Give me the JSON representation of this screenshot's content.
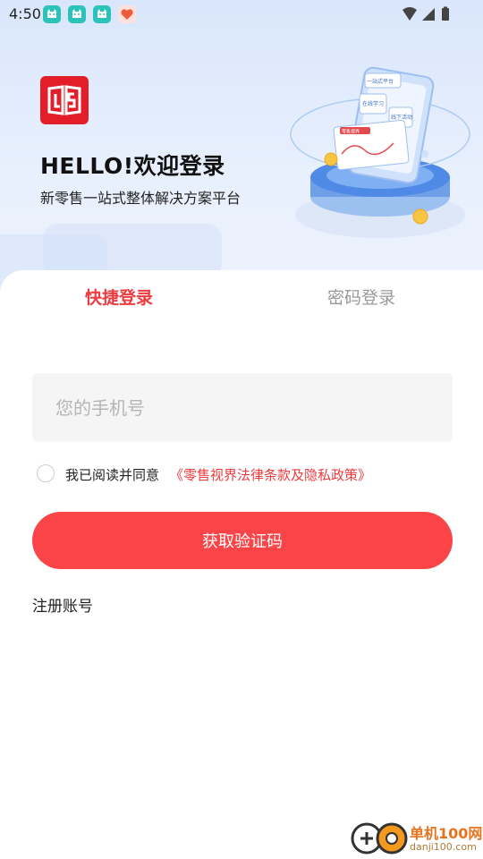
{
  "status_bar": {
    "time": "4:50",
    "notification_icons": [
      "cat-app-icon",
      "cat-app-icon",
      "cat-app-icon",
      "heart-app-icon"
    ],
    "system_icons": [
      "wifi-icon",
      "signal-icon",
      "battery-icon"
    ]
  },
  "brand": {
    "logo_icon": "book-logo-icon",
    "welcome": "HELLO!欢迎登录",
    "subtitle": "新零售一站式整体解决方案平台"
  },
  "illustration": {
    "labels": [
      "一站式平台",
      "在线学习",
      "线下活动",
      "零售视界"
    ]
  },
  "tabs": {
    "quick_login": "快捷登录",
    "password_login": "密码登录",
    "active": "quick_login"
  },
  "form": {
    "phone_placeholder": "您的手机号",
    "phone_value": "",
    "agree_text": "我已阅读并同意",
    "agree_link": "《零售视界法律条款及隐私政策》",
    "agree_checked": false,
    "get_code_button": "获取验证码",
    "register_link": "注册账号"
  },
  "watermark": {
    "name": "单机100网",
    "url": "danji100.com"
  },
  "colors": {
    "accent": "#fb4447",
    "link": "#ee3b3f",
    "hero_bg": "#dde8fb"
  }
}
